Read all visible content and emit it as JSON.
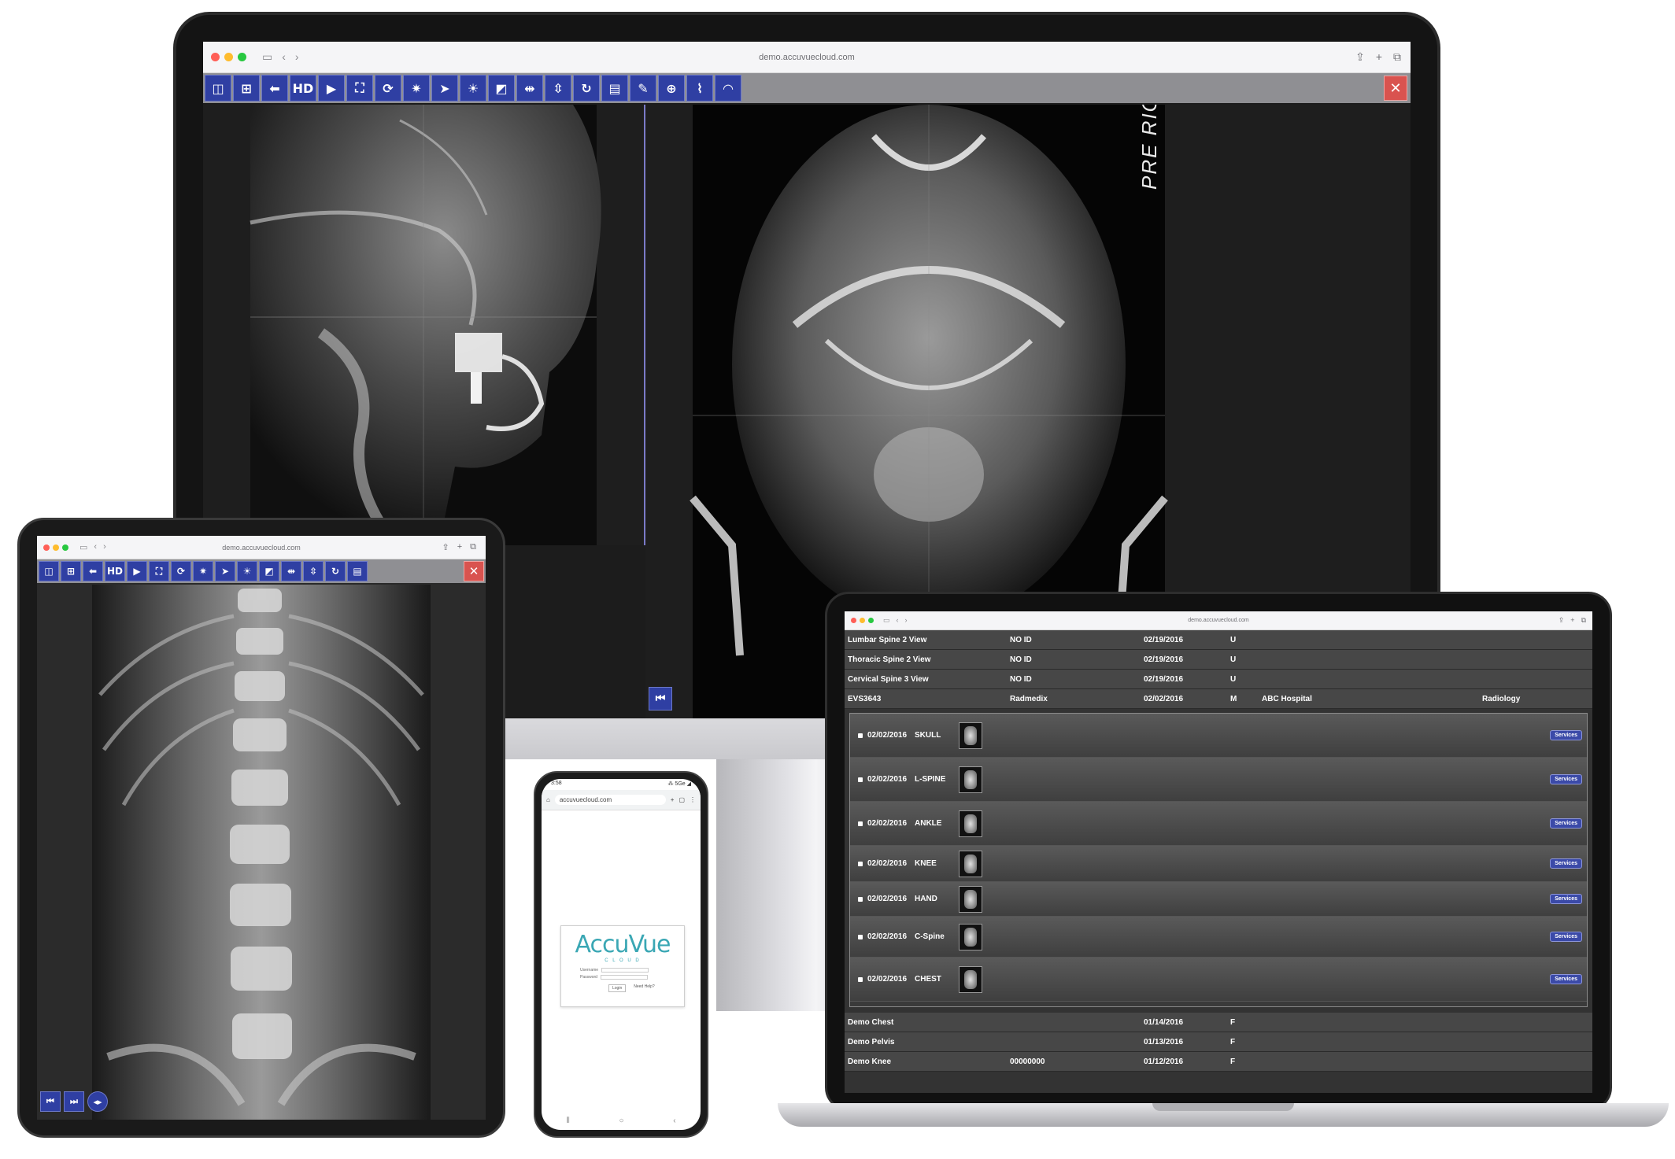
{
  "monitor": {
    "url": "demo.accuvuecloud.com",
    "toolbar": [
      {
        "icon": "split-view-icon",
        "glyph": "◫"
      },
      {
        "icon": "grid-view-icon",
        "glyph": "⊞"
      },
      {
        "icon": "back-arrow-icon",
        "glyph": "⬅"
      },
      {
        "icon": "hd-icon",
        "glyph": "HD"
      },
      {
        "icon": "play-icon",
        "glyph": "▶"
      },
      {
        "icon": "fit-screen-icon",
        "glyph": "⛶"
      },
      {
        "icon": "rotate-icon",
        "glyph": "⟳"
      },
      {
        "icon": "window-level-icon",
        "glyph": "✷"
      },
      {
        "icon": "pointer-icon",
        "glyph": "➤"
      },
      {
        "icon": "brightness-icon",
        "glyph": "☀"
      },
      {
        "icon": "invert-icon",
        "glyph": "◩"
      },
      {
        "icon": "flip-horizontal-icon",
        "glyph": "⇹"
      },
      {
        "icon": "flip-vertical-icon",
        "glyph": "⇳"
      },
      {
        "icon": "reset-icon",
        "glyph": "↻"
      },
      {
        "icon": "ruler-icon",
        "glyph": "▤"
      },
      {
        "icon": "annotate-icon",
        "glyph": "✎"
      },
      {
        "icon": "magnify-icon",
        "glyph": "⊕"
      },
      {
        "icon": "foot-icon",
        "glyph": "⌇"
      },
      {
        "icon": "hide-icon",
        "glyph": "◠"
      }
    ],
    "close_glyph": "✕",
    "right_panel_label": "PRE RIGH",
    "first_frame_glyph": "⏮"
  },
  "tablet": {
    "url": "demo.accuvuecloud.com",
    "toolbar": [
      {
        "icon": "split-view-icon",
        "glyph": "◫"
      },
      {
        "icon": "grid-view-icon",
        "glyph": "⊞"
      },
      {
        "icon": "back-arrow-icon",
        "glyph": "⬅"
      },
      {
        "icon": "hd-icon",
        "glyph": "HD"
      },
      {
        "icon": "play-icon",
        "glyph": "▶"
      },
      {
        "icon": "fit-screen-icon",
        "glyph": "⛶"
      },
      {
        "icon": "rotate-icon",
        "glyph": "⟳"
      },
      {
        "icon": "window-level-icon",
        "glyph": "✷"
      },
      {
        "icon": "pointer-icon",
        "glyph": "➤"
      },
      {
        "icon": "brightness-icon",
        "glyph": "☀"
      },
      {
        "icon": "invert-icon",
        "glyph": "◩"
      },
      {
        "icon": "flip-horizontal-icon",
        "glyph": "⇹"
      },
      {
        "icon": "flip-vertical-icon",
        "glyph": "⇳"
      },
      {
        "icon": "reset-icon",
        "glyph": "↻"
      },
      {
        "icon": "ruler-icon",
        "glyph": "▤"
      }
    ],
    "close_glyph": "✕",
    "nav": [
      {
        "icon": "first-frame-icon",
        "glyph": "⏮"
      },
      {
        "icon": "last-frame-icon",
        "glyph": "⏭"
      },
      {
        "icon": "cine-icon",
        "glyph": "◂▸"
      }
    ]
  },
  "phone": {
    "status_time": "3:58",
    "status_right": "⁂ 5Ge ◢",
    "url": "accuvuecloud.com",
    "logo_main": "AccuVue",
    "logo_sub": "C L O U D",
    "username_label": "Username",
    "password_label": "Password",
    "login_label": "Login",
    "forgot_label": "Need Help?"
  },
  "laptop": {
    "url": "demo.accuvuecloud.com",
    "rows_top": [
      {
        "name": "Lumbar Spine 2 View",
        "id": "NO ID",
        "date": "02/19/2016",
        "sex": "U",
        "facility": "",
        "dept": ""
      },
      {
        "name": "Thoracic Spine 2 View",
        "id": "NO ID",
        "date": "02/19/2016",
        "sex": "U",
        "facility": "",
        "dept": ""
      },
      {
        "name": "Cervical Spine 3 View",
        "id": "NO ID",
        "date": "02/19/2016",
        "sex": "U",
        "facility": "",
        "dept": ""
      },
      {
        "name": "EVS3643",
        "id": "Radmedix",
        "date": "02/02/2016",
        "sex": "M",
        "facility": "ABC Hospital",
        "dept": "Radiology"
      }
    ],
    "studies": [
      {
        "date": "02/02/2016",
        "part": "SKULL",
        "button": "Services"
      },
      {
        "date": "02/02/2016",
        "part": "L-SPINE",
        "button": "Services"
      },
      {
        "date": "02/02/2016",
        "part": "ANKLE",
        "button": "Services"
      },
      {
        "date": "02/02/2016",
        "part": "KNEE",
        "button": "Services"
      },
      {
        "date": "02/02/2016",
        "part": "HAND",
        "button": "Services"
      },
      {
        "date": "02/02/2016",
        "part": "C-Spine",
        "button": "Services"
      },
      {
        "date": "02/02/2016",
        "part": "CHEST",
        "button": "Services"
      }
    ],
    "rows_bottom": [
      {
        "name": "Demo Chest",
        "id": "",
        "date": "01/14/2016",
        "sex": "F"
      },
      {
        "name": "Demo Pelvis",
        "id": "",
        "date": "01/13/2016",
        "sex": "F"
      },
      {
        "name": "Demo Knee",
        "id": "00000000",
        "date": "01/12/2016",
        "sex": "F"
      }
    ]
  }
}
